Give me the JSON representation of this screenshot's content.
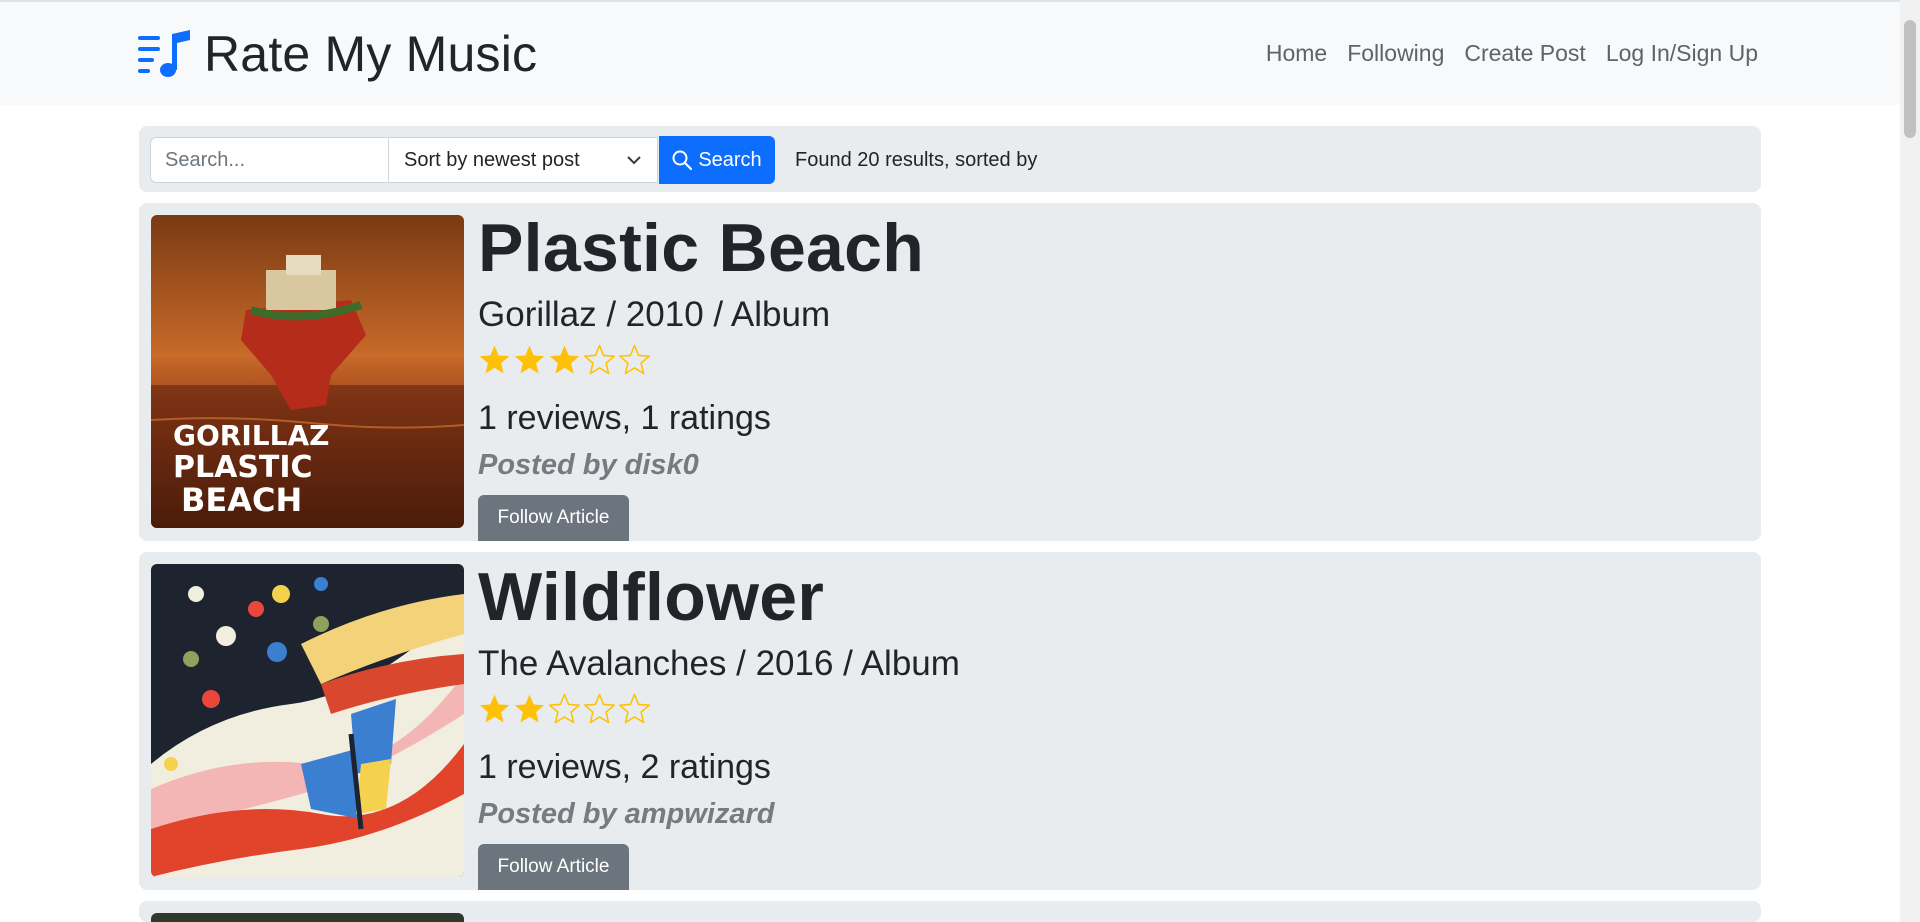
{
  "app": {
    "title": "Rate My Music"
  },
  "icons": {
    "brand": "music-list-icon",
    "search": "search-icon",
    "dropdown": "chevron-down-icon",
    "star_filled": "star-filled-icon",
    "star_empty": "star-outline-icon"
  },
  "colors": {
    "accent": "#0d6efd",
    "star": "#ffc107",
    "secondary": "#6c757d"
  },
  "nav": {
    "items": [
      "Home",
      "Following",
      "Create Post",
      "Log In/Sign Up"
    ]
  },
  "search": {
    "placeholder": "Search...",
    "sort_value": "Sort by newest post",
    "button_label": "Search",
    "results_text": "Found 20 results, sorted by"
  },
  "posts": [
    {
      "title": "Plastic Beach",
      "meta": "Gorillaz / 2010 / Album",
      "rating": 3,
      "max_rating": 5,
      "stats": "1 reviews, 1 ratings",
      "posted_by": "Posted by disk0",
      "cover_text_lines": [
        "GORILLAZ",
        "PLASTIC",
        "BEACH"
      ],
      "follow_label": "Follow Article"
    },
    {
      "title": "Wildflower",
      "meta": "The Avalanches / 2016 / Album",
      "rating": 2,
      "max_rating": 5,
      "stats": "1 reviews, 2 ratings",
      "posted_by": "Posted by ampwizard",
      "follow_label": "Follow Article"
    }
  ]
}
